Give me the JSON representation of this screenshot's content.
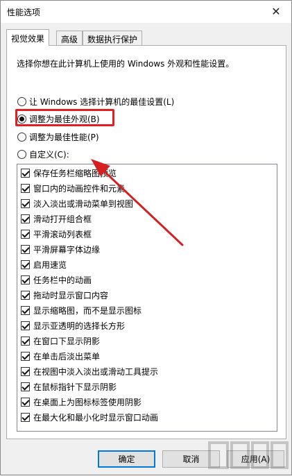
{
  "window": {
    "title": "性能选项",
    "close_glyph": "✕"
  },
  "tabs": [
    {
      "label": "视觉效果",
      "active": true
    },
    {
      "label": "高级",
      "active": false
    },
    {
      "label": "数据执行保护",
      "active": false
    }
  ],
  "panel": {
    "description": "选择你想在此计算机上使用的 Windows 外观和性能设置。",
    "radios": [
      {
        "label": "让 Windows 选择计算机的最佳设置(L)",
        "checked": false
      },
      {
        "label": "调整为最佳外观(B)",
        "checked": true
      },
      {
        "label": "调整为最佳性能(P)",
        "checked": false
      },
      {
        "label": "自定义(C):",
        "checked": false
      }
    ],
    "options": [
      {
        "label": "保存任务栏缩略图预览",
        "checked": true
      },
      {
        "label": "窗口内的动画控件和元素",
        "checked": true
      },
      {
        "label": "淡入淡出或滑动菜单到视图",
        "checked": true
      },
      {
        "label": "滑动打开组合框",
        "checked": true
      },
      {
        "label": "平滑滚动列表框",
        "checked": true
      },
      {
        "label": "平滑屏幕字体边缘",
        "checked": true
      },
      {
        "label": "启用速览",
        "checked": true
      },
      {
        "label": "任务栏中的动画",
        "checked": true
      },
      {
        "label": "拖动时显示窗口内容",
        "checked": true
      },
      {
        "label": "显示缩略图，而不是显示图标",
        "checked": true
      },
      {
        "label": "显示亚透明的选择长方形",
        "checked": true
      },
      {
        "label": "在窗口下显示阴影",
        "checked": true
      },
      {
        "label": "在单击后淡出菜单",
        "checked": true
      },
      {
        "label": "在视图中淡入淡出或滑动工具提示",
        "checked": true
      },
      {
        "label": "在鼠标指针下显示阴影",
        "checked": true
      },
      {
        "label": "在桌面上为图标标签使用阴影",
        "checked": true
      },
      {
        "label": "在最大化和最小化时显示窗口动画",
        "checked": true
      }
    ]
  },
  "buttons": {
    "ok": "确定",
    "cancel": "取消",
    "apply": "应用(A)"
  },
  "annotation": {
    "box_color": "#e02020",
    "arrow_color": "#d42020"
  }
}
